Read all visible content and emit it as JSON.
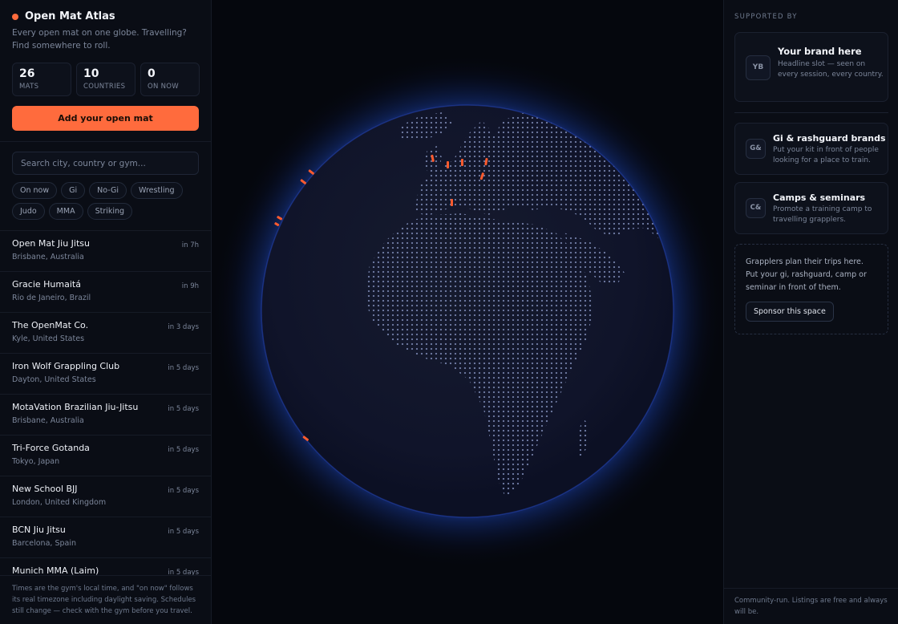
{
  "app": {
    "title": "Open Mat Atlas",
    "tagline": "Every open mat on one globe. Travelling? Find somewhere to roll.",
    "accent_color": "#ff6b3d"
  },
  "stats": [
    {
      "value": "26",
      "label": "MATS"
    },
    {
      "value": "10",
      "label": "COUNTRIES"
    },
    {
      "value": "0",
      "label": "ON NOW"
    }
  ],
  "actions": {
    "add_label": "Add your open mat"
  },
  "search": {
    "placeholder": "Search city, country or gym...",
    "value": ""
  },
  "filters": [
    "On now",
    "Gi",
    "No-Gi",
    "Wrestling",
    "Judo",
    "MMA",
    "Striking"
  ],
  "mats": [
    {
      "name": "Open Mat Jiu Jitsu",
      "location": "Brisbane, Australia",
      "when": "in 7h"
    },
    {
      "name": "Gracie Humaitá",
      "location": "Rio de Janeiro, Brazil",
      "when": "in 9h"
    },
    {
      "name": "The OpenMat Co.",
      "location": "Kyle, United States",
      "when": "in 3 days"
    },
    {
      "name": "Iron Wolf Grappling Club",
      "location": "Dayton, United States",
      "when": "in 5 days"
    },
    {
      "name": "MotaVation Brazilian Jiu-Jitsu",
      "location": "Brisbane, Australia",
      "when": "in 5 days"
    },
    {
      "name": "Tri-Force Gotanda",
      "location": "Tokyo, Japan",
      "when": "in 5 days"
    },
    {
      "name": "New School BJJ",
      "location": "London, United Kingdom",
      "when": "in 5 days"
    },
    {
      "name": "BCN Jiu Jitsu",
      "location": "Barcelona, Spain",
      "when": "in 5 days"
    },
    {
      "name": "Munich MMA (Laim)",
      "location": "",
      "when": "in 5 days"
    }
  ],
  "footnote": "Times are the gym's local time, and \"on now\" follows its real timezone including daylight saving. Schedules still change — check with the gym before you travel.",
  "sponsors": {
    "heading": "SUPPORTED BY",
    "headline": {
      "badge": "YB",
      "title": "Your brand here",
      "desc": "Headline slot — seen on every session, every country."
    },
    "slots": [
      {
        "badge": "G&",
        "title": "Gi & rashguard brands",
        "desc": "Put your kit in front of people looking for a place to train."
      },
      {
        "badge": "C&",
        "title": "Camps & seminars",
        "desc": "Promote a training camp to travelling grapplers."
      }
    ],
    "pitch": "Grapplers plan their trips here. Put your gi, rashguard, camp or seminar in front of them.",
    "pitch_button": "Sponsor this space",
    "footer": "Community-run. Listings are free and always will be."
  }
}
